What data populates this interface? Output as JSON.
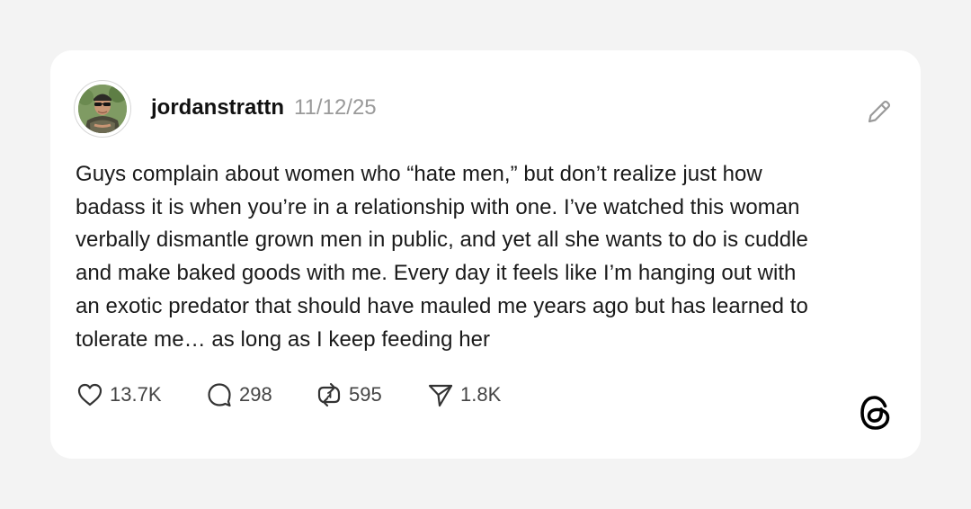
{
  "post": {
    "username": "jordanstrattn",
    "date": "11/12/25",
    "text_lines": [
      "Guys complain about women who “hate men,” but don’t realize just how",
      "badass it is when you’re in a relationship with one. I’ve watched this woman",
      "verbally dismantle grown men in public, and yet all she wants to do is cuddle",
      "and make baked goods with me. Every day it feels like I’m hanging out with",
      "an exotic predator that should have mauled me years ago but has learned to",
      "tolerate me… as long as I keep feeding her"
    ]
  },
  "actions": {
    "likes": "13.7K",
    "replies": "298",
    "reposts": "595",
    "shares": "1.8K"
  },
  "icons": {
    "edit": "pencil-icon",
    "like": "heart-icon",
    "reply": "speech-bubble-icon",
    "repost": "repost-icon",
    "share": "send-icon",
    "brand": "threads-logo"
  },
  "colors": {
    "background": "#f3f3f3",
    "card": "#ffffff",
    "text": "#1a1a1a",
    "muted": "#9a9a9a"
  }
}
